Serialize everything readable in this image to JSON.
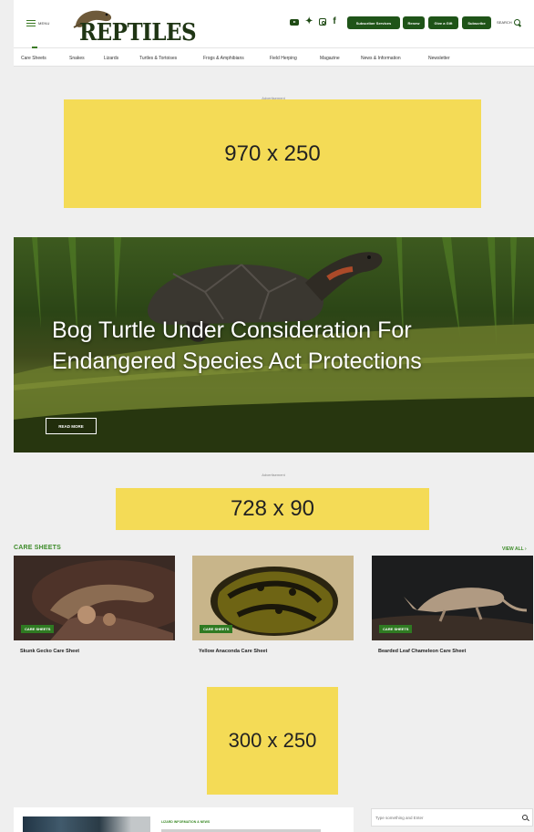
{
  "header": {
    "menu_label": "MENU",
    "logo_text": "REPTILES",
    "buttons": [
      "Subscriber Services",
      "Renew",
      "Give a Gift",
      "Subscribe"
    ],
    "search_label": "SEARCH",
    "social_icons": [
      "youtube-icon",
      "twitter-icon",
      "instagram-icon",
      "facebook-icon"
    ],
    "accent_color": "#1f5418"
  },
  "nav": {
    "items": [
      "Care Sheets",
      "Snakes",
      "Lizards",
      "Turtles & Tortoises",
      "Frogs & Amphibians",
      "Field Herping",
      "Magazine",
      "News & Information",
      "Newsletter"
    ]
  },
  "ads": {
    "top_label": "Advertisement",
    "top_size": "970 x 250",
    "mid_label": "Advertisement",
    "mid_size": "728 x 90",
    "side_size": "300 x 250",
    "color": "#f4db56"
  },
  "hero": {
    "title_line1": "Bog Turtle Under Consideration For",
    "title_line2": "Endangered Species Act Protections",
    "button": "READ MORE"
  },
  "care_sheets": {
    "section_title": "CARE SHEETS",
    "view_all": "VIEW ALL",
    "cards": [
      {
        "badge": "CARE SHEETS",
        "title": "Skunk Gecko Care Sheet"
      },
      {
        "badge": "CARE SHEETS",
        "title": "Yellow Anaconda Care Sheet"
      },
      {
        "badge": "CARE SHEETS",
        "title": "Bearded Leaf Chameleon Care Sheet"
      }
    ]
  },
  "article": {
    "category": "LIZARD INFORMATION & NEWS"
  },
  "sidebar": {
    "search_placeholder": "Type something and Enter"
  }
}
